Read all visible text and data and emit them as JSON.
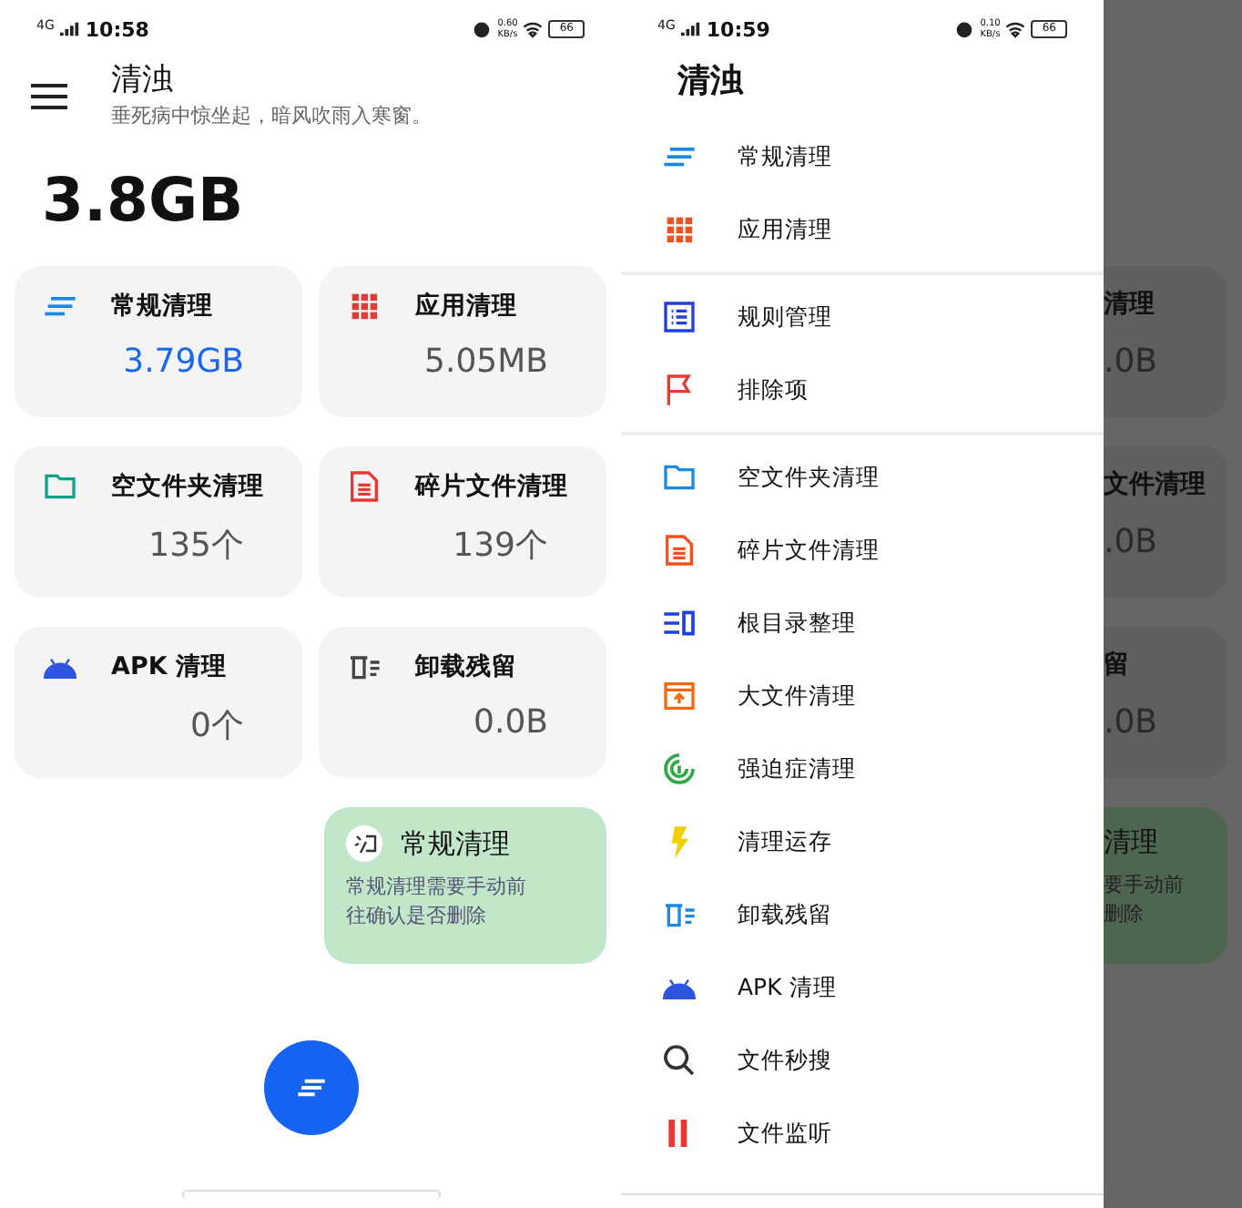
{
  "main_screen": {
    "status_bar": {
      "network": "4G",
      "time": "10:58",
      "speed": "0.60",
      "speed_unit": "KB/s",
      "battery": "66"
    },
    "app_bar": {
      "title": "清浊",
      "subtitle": "垂死病中惊坐起，暗风吹雨入寒窗。"
    },
    "total": "3.8GB",
    "cards": [
      {
        "title": "常规清理",
        "value": "3.79GB",
        "kind": "lines",
        "color": "#1e88e5",
        "active": true
      },
      {
        "title": "应用清理",
        "value": "5.05MB",
        "kind": "grid",
        "color": "#e53935",
        "active": false
      },
      {
        "title": "空文件夹清理",
        "value": "135个",
        "kind": "folder",
        "color": "#11a08a",
        "active": false
      },
      {
        "title": "碎片文件清理",
        "value": "139个",
        "kind": "doc",
        "color": "#e53935",
        "active": false
      },
      {
        "title": "APK 清理",
        "value": "0个",
        "kind": "android",
        "color": "#2d55e0",
        "active": false
      },
      {
        "title": "卸载残留",
        "value": "0.0B",
        "kind": "trash",
        "color": "#444444",
        "active": false
      }
    ],
    "tip": {
      "title": "常规清理",
      "text": "常规清理需要手动前往确认是否删除"
    }
  },
  "drawer_screen": {
    "status_bar": {
      "network": "4G",
      "time": "10:59",
      "speed": "0.10",
      "speed_unit": "KB/s",
      "battery": "66"
    },
    "drawer": {
      "title": "清浊",
      "sections": [
        [
          {
            "label": "常规清理",
            "kind": "lines",
            "color": "#1e88e5"
          },
          {
            "label": "应用清理",
            "kind": "grid",
            "color": "#f4511e"
          }
        ],
        [
          {
            "label": "规则管理",
            "kind": "list",
            "color": "#1e40e0"
          },
          {
            "label": "排除项",
            "kind": "flag",
            "color": "#e53935"
          }
        ],
        [
          {
            "label": "空文件夹清理",
            "kind": "folder",
            "color": "#1e88e5"
          },
          {
            "label": "碎片文件清理",
            "kind": "doc",
            "color": "#f4511e"
          },
          {
            "label": "根目录整理",
            "kind": "rootdir",
            "color": "#1e40e0"
          },
          {
            "label": "大文件清理",
            "kind": "bigfile",
            "color": "#f4690e"
          },
          {
            "label": "强迫症清理",
            "kind": "target",
            "color": "#2eaa44"
          },
          {
            "label": "清理运存",
            "kind": "bolt",
            "color": "#f0d000"
          },
          {
            "label": "卸载残留",
            "kind": "trash",
            "color": "#1e88e5"
          },
          {
            "label": "APK 清理",
            "kind": "android",
            "color": "#2d55e0"
          },
          {
            "label": "文件秒搜",
            "kind": "search",
            "color": "#333333"
          },
          {
            "label": "文件监听",
            "kind": "monitor",
            "color": "#e53935"
          }
        ]
      ]
    },
    "behind": [
      {
        "kind": "card",
        "lines": [
          "清理",
          ".0B"
        ]
      },
      {
        "kind": "card",
        "lines": [
          "文件清理",
          ".0B"
        ]
      },
      {
        "kind": "card",
        "lines": [
          "留",
          ".0B"
        ]
      },
      {
        "kind": "tip",
        "lines": [
          "清理",
          "要手动前",
          "删除"
        ]
      }
    ]
  }
}
